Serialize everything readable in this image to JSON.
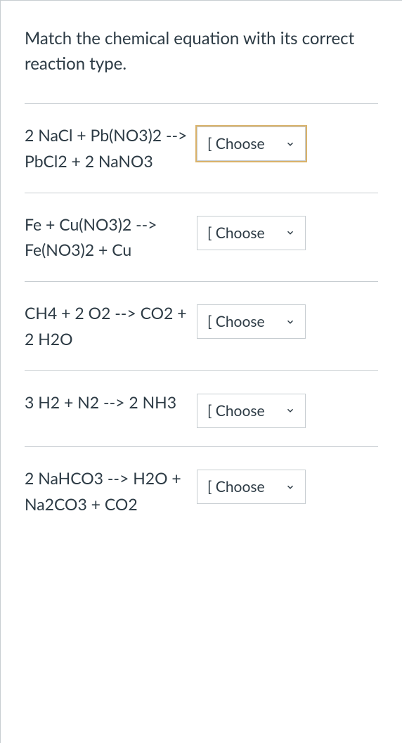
{
  "question": {
    "text": "Match the chemical equation with its correct reaction type."
  },
  "selectPlaceholder": "[ Choose",
  "items": [
    {
      "equation": "2 NaCl + Pb(NO3)2 --> PbCl2 + 2 NaNO3",
      "selected": "[ Choose",
      "focused": true
    },
    {
      "equation": "Fe + Cu(NO3)2 --> Fe(NO3)2 + Cu",
      "selected": "[ Choose",
      "focused": false
    },
    {
      "equation": "CH4 + 2 O2 --> CO2 + 2 H2O",
      "selected": "[ Choose",
      "focused": false
    },
    {
      "equation": "3 H2 + N2 --> 2 NH3",
      "selected": "[ Choose",
      "focused": false
    },
    {
      "equation": "2 NaHCO3 --> H2O + Na2CO3 + CO2",
      "selected": "[ Choose",
      "focused": false
    }
  ]
}
